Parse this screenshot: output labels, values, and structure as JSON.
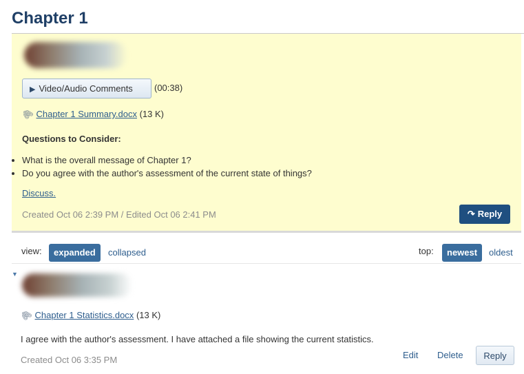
{
  "page": {
    "title": "Chapter 1"
  },
  "post": {
    "media_button_label": "Video/Audio Comments",
    "media_duration": "(00:38)",
    "attachment": {
      "name": "Chapter 1 Summary.docx",
      "size": "(13 K)"
    },
    "questions_heading": "Questions to Consider:",
    "questions": [
      "What is the overall message of Chapter 1?",
      "Do you agree with the author's assessment of the current state of things?"
    ],
    "discuss_link": "Discuss.",
    "created": "Created Oct 06 2:39 PM / Edited Oct 06 2:41 PM",
    "reply_label": "Reply"
  },
  "toolbar": {
    "view_label": "view:",
    "view_options": [
      "expanded",
      "collapsed"
    ],
    "view_selected": "expanded",
    "top_label": "top:",
    "sort_options": [
      "newest",
      "oldest"
    ],
    "sort_selected": "newest"
  },
  "comment": {
    "attachment": {
      "name": "Chapter 1 Statistics.docx",
      "size": "(13 K)"
    },
    "text": "I agree with the author's assessment. I have attached a file showing the current statistics.",
    "created": "Created Oct 06 3:35 PM",
    "edit_label": "Edit",
    "delete_label": "Delete",
    "reply_label": "Reply"
  },
  "icons": {
    "play": "play-icon",
    "attachment": "paperclip-icon",
    "reply": "reply-arrow-icon",
    "collapse": "caret-down-icon"
  },
  "colors": {
    "title": "#1f3f66",
    "post_background": "#fefdcf",
    "primary_button": "#1f4f80",
    "active_pill": "#3a6d9e",
    "link": "#2d5d8d"
  }
}
